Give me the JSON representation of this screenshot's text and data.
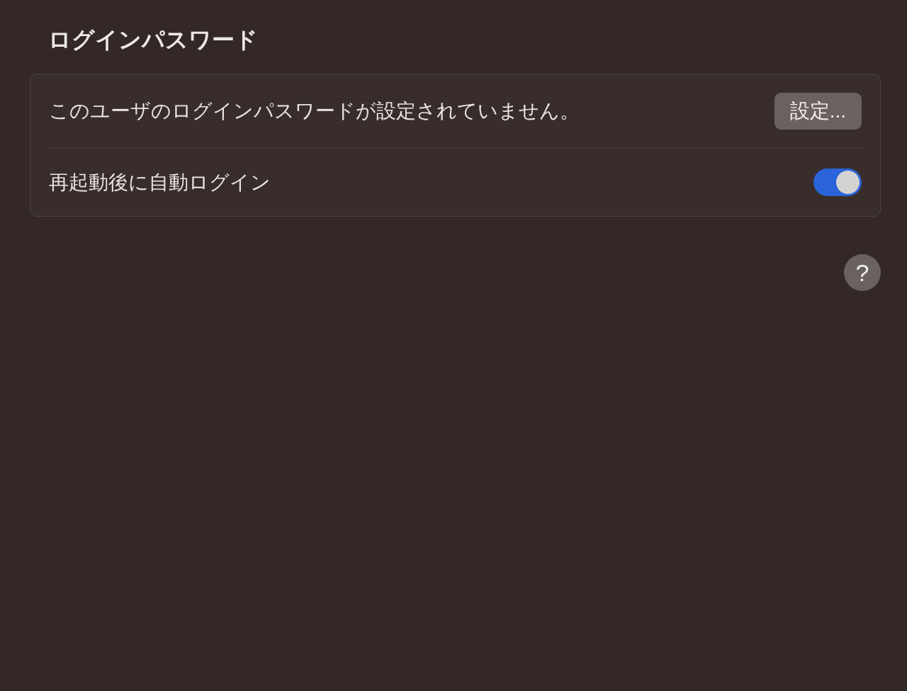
{
  "title": "ログインパスワード",
  "rows": [
    {
      "kind": "button",
      "label": "このユーザのログインパスワードが設定されていません。",
      "button": "設定..."
    },
    {
      "kind": "toggle",
      "label": "再起動後に自動ログイン",
      "on": true
    }
  ],
  "help": "?"
}
